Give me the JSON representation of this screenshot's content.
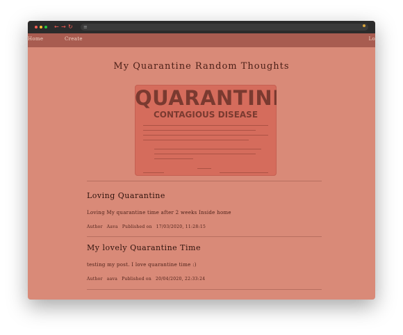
{
  "browser": {
    "back_icon": "back-arrow-icon",
    "forward_icon": "forward-arrow-icon",
    "reload_icon": "reload-icon"
  },
  "nav": {
    "home": "Home",
    "create": "Create",
    "right": "Lo"
  },
  "page": {
    "title": "My Quarantine Random Thoughts"
  },
  "hero": {
    "heading": "QUARANTINE",
    "subheading": "CONTAGIOUS DISEASE"
  },
  "posts": [
    {
      "title": "Loving Quarantine",
      "body": "Loving My quarantine time after 2 weeks Inside home",
      "author_label": "Author",
      "author": "Aava",
      "published_label": "Published on",
      "date": "17/03/2020, 11:28:15"
    },
    {
      "title": "My lovely Quarantine Time",
      "body": "testing my post. I love quarantine time :)",
      "author_label": "Author",
      "author": "aava",
      "published_label": "Published on",
      "date": "20/04/2020, 22:33:24"
    }
  ],
  "colors": {
    "page_bg": "#d98a78",
    "navbar_bg": "#a85c50",
    "text_dark": "#2f120c"
  }
}
